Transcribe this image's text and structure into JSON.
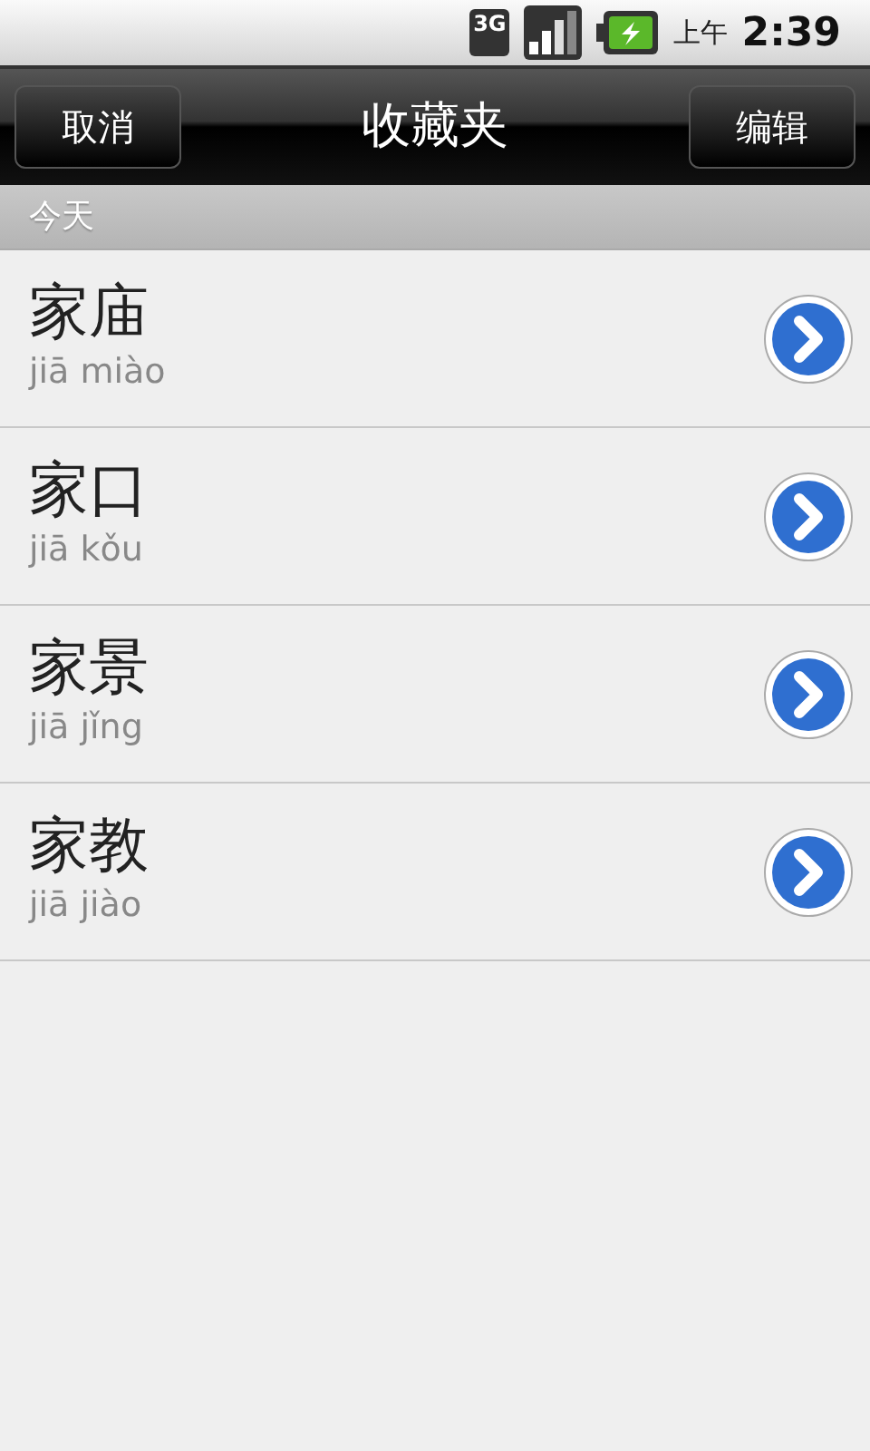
{
  "status_bar": {
    "network": "3G",
    "ampm": "上午",
    "time": "2:39"
  },
  "header": {
    "left_button": "取消",
    "title": "收藏夹",
    "right_button": "编辑"
  },
  "section": {
    "title": "今天"
  },
  "items": [
    {
      "word": "家庙",
      "pinyin": "jiā miào"
    },
    {
      "word": "家口",
      "pinyin": "jiā kǒu"
    },
    {
      "word": "家景",
      "pinyin": "jiā jǐng"
    },
    {
      "word": "家教",
      "pinyin": "jiā jiào"
    }
  ]
}
